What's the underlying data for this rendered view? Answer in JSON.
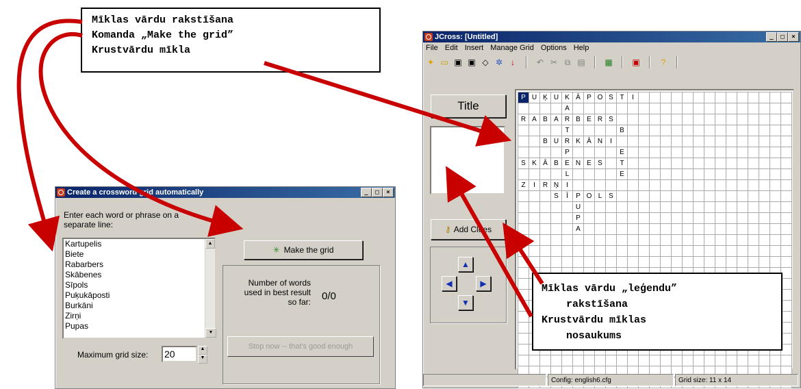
{
  "callout_top": {
    "lines": [
      "Mīklas vārdu rakstīšana",
      "Komanda „Make the grid”",
      "Krustvārdu mīkla"
    ]
  },
  "callout_bottom": {
    "lines": [
      "Mīklas vārdu „leģendu”",
      "rakstīšana",
      "Krustvārdu mīklas",
      "nosaukums"
    ]
  },
  "create_dialog": {
    "title": "Create a crossword grid automatically",
    "instruction": "Enter each word or phrase on a separate line:",
    "words": [
      "Kartupelis",
      "Biete",
      "Rabarbers",
      "Skābenes",
      "Sīpols",
      "Puķukāposti",
      "Burkāni",
      "Zirņi",
      "Pupas"
    ],
    "make_grid_label": "Make the grid",
    "count_label": "Number of words used in best result so far:",
    "count_value": "0/0",
    "stop_label": "Stop now -- that's good enough",
    "max_size_label": "Maximum grid size:",
    "max_size_value": "20"
  },
  "jcross": {
    "title": "JCross: [Untitled]",
    "menu": [
      "File",
      "Edit",
      "Insert",
      "Manage Grid",
      "Options",
      "Help"
    ],
    "title_button": "Title",
    "add_clues_label": "Add Clues",
    "status_config": "Config: english6.cfg",
    "status_grid": "Grid size: 11 x 14",
    "grid_rows": [
      "PUĶUKĀPOSTI",
      "    A      ",
      "RABARBERS  ",
      "    T    B ",
      "  BURKĀNI  ",
      "    P    E ",
      "SKĀBENES T ",
      "    L    E ",
      "ZIRŅI      ",
      "   SĪPOLS  ",
      "     U     ",
      "     P     ",
      "     A     "
    ]
  }
}
